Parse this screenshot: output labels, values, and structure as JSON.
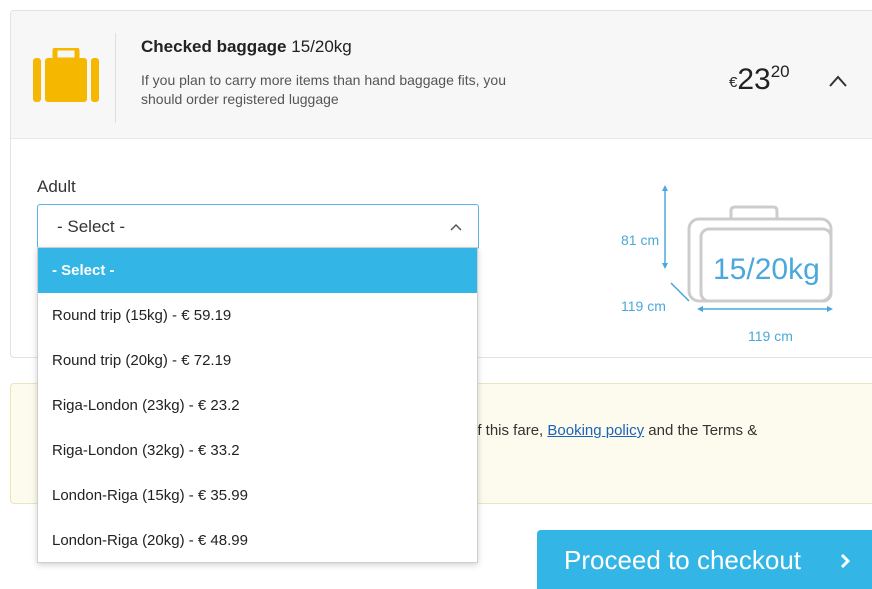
{
  "colors": {
    "accent": "#33b5e5",
    "bag_icon": "#f5b700",
    "dimension": "#4aa8dc",
    "link": "#1a63b8",
    "notice_bg": "#fdfbed"
  },
  "baggage": {
    "icon": "suitcase-icon",
    "title": "Checked baggage",
    "title_weight": "15/20kg",
    "description": "If you plan to carry more items than hand baggage fits, you should order registered luggage",
    "price_currency": "€",
    "price_integer": "23",
    "price_decimal": "20",
    "collapse_icon": "chevron-up-icon"
  },
  "passenger": {
    "label": "Adult",
    "selected_value": "- Select -",
    "options": [
      "- Select -",
      "Round trip (15kg) - € 59.19",
      "Round trip (20kg) - € 72.19",
      "Riga-London (23kg) - € 23.2",
      "Riga-London (32kg) - € 33.2",
      "London-Riga (15kg) - € 35.99",
      "London-Riga (20kg) - € 48.99"
    ]
  },
  "diagram": {
    "height": "81 cm",
    "depth": "119 cm",
    "width": "119 cm",
    "weight": "15/20kg"
  },
  "notice": {
    "text_before": "of this fare, ",
    "link": "Booking policy",
    "text_after": " and the Terms &"
  },
  "checkout": {
    "label": "Proceed to checkout",
    "icon": "chevron-right-icon"
  }
}
